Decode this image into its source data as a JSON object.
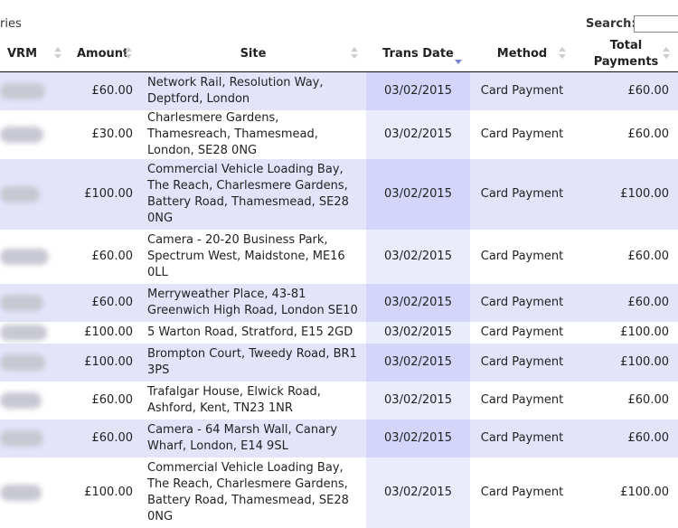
{
  "toolbar": {
    "entries_text": "ries",
    "search_label": "Search:",
    "search_value": ""
  },
  "headers": {
    "vrm": "VRM",
    "amount": "Amount",
    "site": "Site",
    "trans_date": "Trans Date",
    "method": "Method",
    "total_payments": "Total Payments"
  },
  "rows": [
    {
      "amount": "£60.00",
      "site": "Network Rail, Resolution Way, Deptford, London",
      "date": "03/02/2015",
      "method": "Card Payment",
      "total": "£60.00"
    },
    {
      "amount": "£30.00",
      "site": "Charlesmere Gardens, Thamesreach, Thamesmead, London, SE28 0NG",
      "date": "03/02/2015",
      "method": "Card Payment",
      "total": "£60.00"
    },
    {
      "amount": "£100.00",
      "site": "Commercial Vehicle Loading Bay, The Reach, Charlesmere Gardens, Battery Road, Thamesmead, SE28 0NG",
      "date": "03/02/2015",
      "method": "Card Payment",
      "total": "£100.00"
    },
    {
      "amount": "£60.00",
      "site": "Camera - 20-20 Business Park, Spectrum West, Maidstone, ME16 0LL",
      "date": "03/02/2015",
      "method": "Card Payment",
      "total": "£60.00"
    },
    {
      "amount": "£60.00",
      "site": "Merryweather Place, 43-81 Greenwich High Road, London SE10",
      "date": "03/02/2015",
      "method": "Card Payment",
      "total": "£60.00"
    },
    {
      "amount": "£100.00",
      "site": "5 Warton Road, Stratford, E15 2GD",
      "date": "03/02/2015",
      "method": "Card Payment",
      "total": "£100.00"
    },
    {
      "amount": "£100.00",
      "site": "Brompton Court, Tweedy Road, BR1 3PS",
      "date": "03/02/2015",
      "method": "Card Payment",
      "total": "£100.00"
    },
    {
      "amount": "£60.00",
      "site": "Trafalgar House, Elwick Road, Ashford, Kent, TN23 1NR",
      "date": "03/02/2015",
      "method": "Card Payment",
      "total": "£60.00"
    },
    {
      "amount": "£60.00",
      "site": "Camera - 64 Marsh Wall, Canary Wharf, London, E14 9SL",
      "date": "03/02/2015",
      "method": "Card Payment",
      "total": "£60.00"
    },
    {
      "amount": "£100.00",
      "site": "Commercial Vehicle Loading Bay, The Reach, Charlesmere Gardens, Battery Road, Thamesmead, SE28 0NG",
      "date": "03/02/2015",
      "method": "Card Payment",
      "total": "£100.00"
    }
  ]
}
